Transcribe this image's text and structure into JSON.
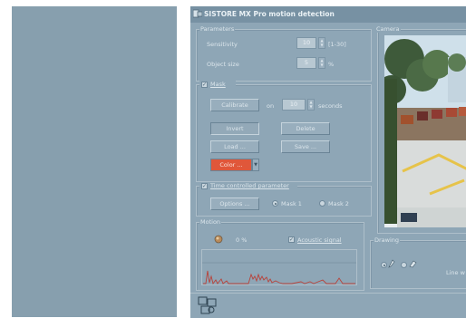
{
  "window": {
    "title": "SISTORE MX Pro motion detection"
  },
  "parameters": {
    "group_label": "Parameters",
    "sensitivity": {
      "label": "Sensitivity",
      "value": "10",
      "range": "[1-30]"
    },
    "object_size": {
      "label": "Object size",
      "value": "5",
      "unit": "%"
    }
  },
  "mask": {
    "group_label": "Mask",
    "checked": true,
    "calibrate_label": "Calibrate",
    "on_label": "on",
    "seconds_value": "10",
    "seconds_label": "seconds",
    "invert_label": "Invert",
    "delete_label": "Delete",
    "load_label": "Load ...",
    "save_label": "Save ...",
    "color_label": "Color ...",
    "color_swatch": "#e0573a"
  },
  "time_controlled": {
    "label": "Time controlled parameter",
    "checked": true,
    "options_label": "Options ...",
    "mask1_label": "Mask 1",
    "mask2_label": "Mask 2",
    "selected": "Mask 1"
  },
  "motion": {
    "group_label": "Motion",
    "percent": "0 %",
    "acoustic_label": "Acoustic signal",
    "acoustic_checked": true
  },
  "camera": {
    "group_label": "Camera"
  },
  "drawing": {
    "group_label": "Drawing",
    "line_label": "Line w"
  },
  "colors": {
    "window_bg": "#8ea6b6",
    "left_panel": "#879fae",
    "graph_line": "#b8423a"
  }
}
